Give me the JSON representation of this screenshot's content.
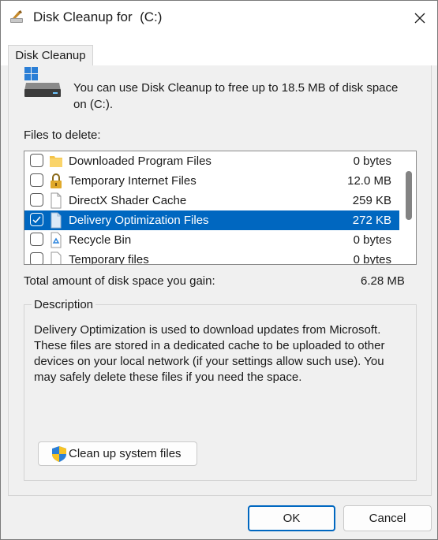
{
  "window": {
    "title": "Disk Cleanup for  (C:)"
  },
  "tab": {
    "label": "Disk Cleanup"
  },
  "intro": {
    "text": "You can use Disk Cleanup to free up to 18.5 MB of disk space on  (C:)."
  },
  "files": {
    "label": "Files to delete:",
    "items": [
      {
        "name": "Downloaded Program Files",
        "size": "0 bytes",
        "checked": false,
        "icon": "folder-icon"
      },
      {
        "name": "Temporary Internet Files",
        "size": "12.0 MB",
        "checked": false,
        "icon": "lock-icon"
      },
      {
        "name": "DirectX Shader Cache",
        "size": "259 KB",
        "checked": false,
        "icon": "file-icon"
      },
      {
        "name": "Delivery Optimization Files",
        "size": "272 KB",
        "checked": true,
        "selected": true,
        "icon": "file-icon"
      },
      {
        "name": "Recycle Bin",
        "size": "0 bytes",
        "checked": false,
        "icon": "recycle-bin-icon"
      },
      {
        "name": "Temporary files",
        "size": "0 bytes",
        "checked": false,
        "icon": "file-icon"
      }
    ]
  },
  "total": {
    "label": "Total amount of disk space you gain:",
    "value": "6.28 MB"
  },
  "description": {
    "legend": "Description",
    "text": "Delivery Optimization is used to download updates from Microsoft. These files are stored in a dedicated cache to be uploaded to other devices on your local network (if your settings allow such use). You may safely delete these files if you need the space."
  },
  "buttons": {
    "cleanup_system": "Clean up system files",
    "ok": "OK",
    "cancel": "Cancel"
  },
  "colors": {
    "accent": "#0067c0",
    "background": "#f0f0f0"
  }
}
